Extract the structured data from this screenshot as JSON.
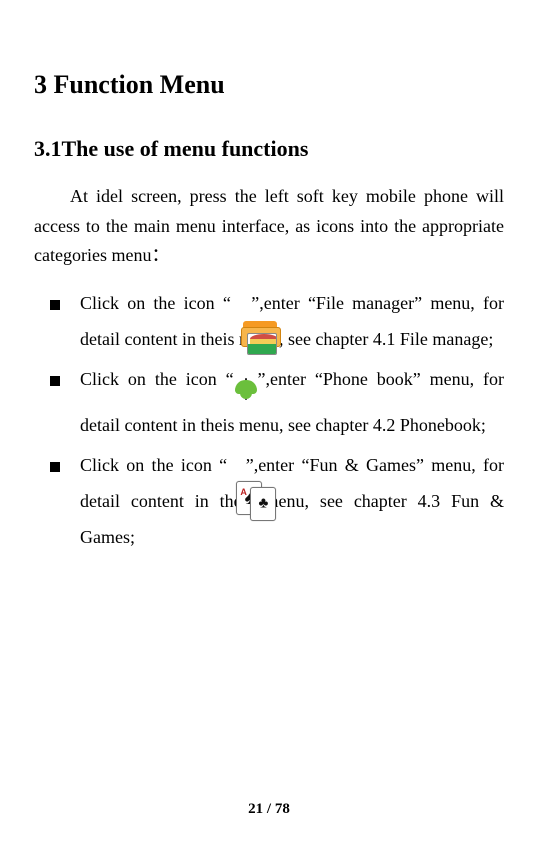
{
  "headings": {
    "h1": "3 Function Menu",
    "h2": "3.1The use of menu functions"
  },
  "intro": "At idel screen, press the left soft key mobile phone will access to the main menu interface, as icons into the appropriate categories menu：",
  "items": [
    {
      "pre": "Click on the icon “",
      "post": "”,enter “File manager” menu, for detail content in theis menu, see chapter 4.1 File manage;",
      "icon": "file-manager-icon"
    },
    {
      "pre": "Click on the icon “",
      "post": "”,enter “Phone book” menu, for detail content in theis menu, see chapter 4.2 Phonebook;",
      "icon": "phone-book-icon"
    },
    {
      "pre": "Click on the icon “",
      "post": "”,enter “Fun & Games” menu, for detail content in theis menu, see chapter 4.3 Fun & Games;",
      "icon": "fun-games-icon"
    }
  ],
  "footer": "21 / 78"
}
